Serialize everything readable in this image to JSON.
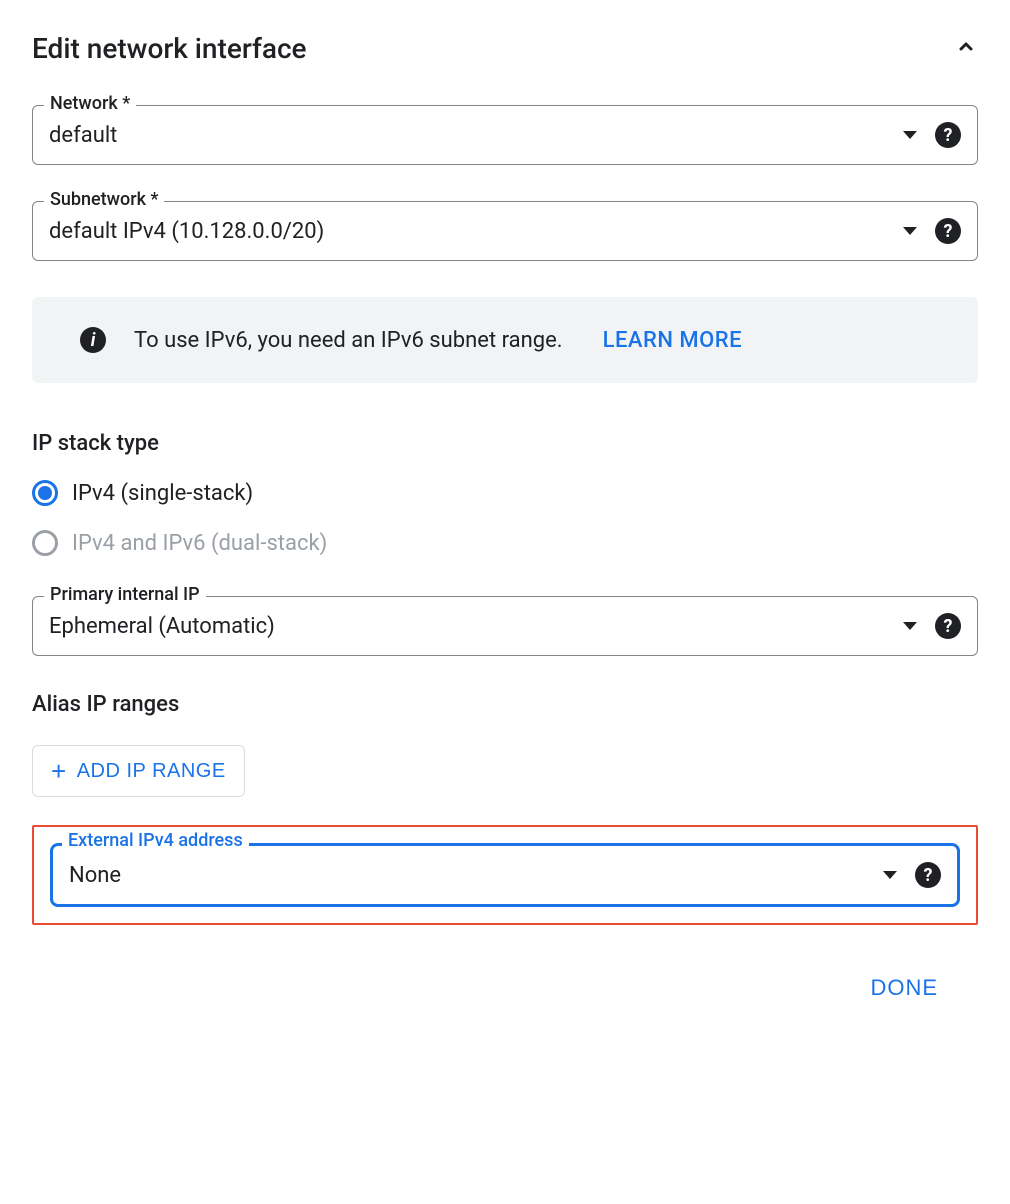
{
  "header": {
    "title": "Edit network interface"
  },
  "network": {
    "label": "Network *",
    "value": "default"
  },
  "subnetwork": {
    "label": "Subnetwork *",
    "value": "default IPv4 (10.128.0.0/20)"
  },
  "info_banner": {
    "text": "To use IPv6, you need an IPv6 subnet range.",
    "learn_more": "LEARN MORE"
  },
  "ip_stack": {
    "label": "IP stack type",
    "options": [
      {
        "label": "IPv4 (single-stack)",
        "selected": true,
        "disabled": false
      },
      {
        "label": "IPv4 and IPv6 (dual-stack)",
        "selected": false,
        "disabled": true
      }
    ]
  },
  "primary_ip": {
    "label": "Primary internal IP",
    "value": "Ephemeral (Automatic)"
  },
  "alias": {
    "label": "Alias IP ranges",
    "add_button": "ADD IP RANGE"
  },
  "external_ip": {
    "label": "External IPv4 address",
    "value": "None"
  },
  "footer": {
    "done": "DONE"
  }
}
